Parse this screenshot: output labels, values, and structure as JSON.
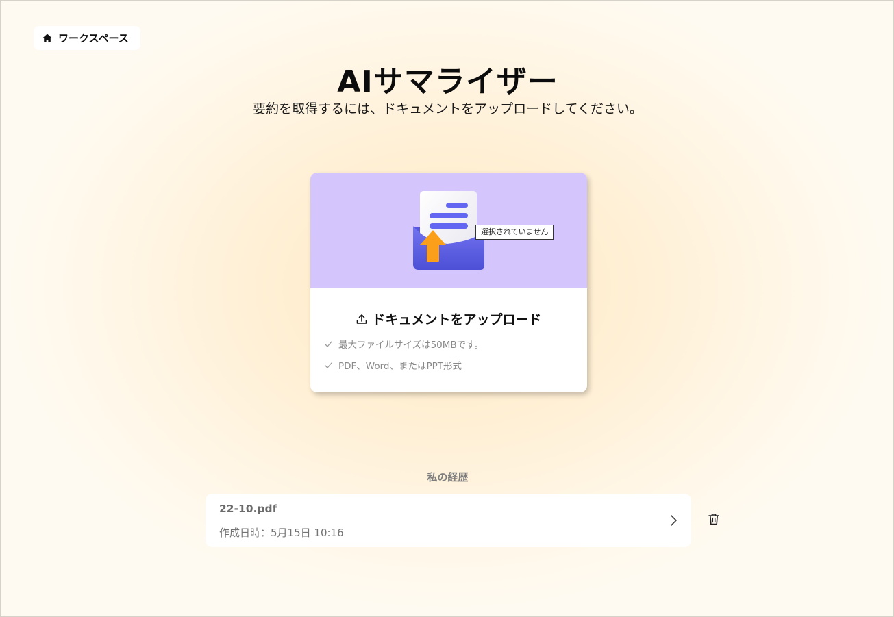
{
  "nav": {
    "workspace_label": "ワークスペース",
    "icon": "home-icon"
  },
  "header": {
    "title": "AIサマライザー",
    "subtitle": "要約を取得するには、ドキュメントをアップロードしてください。"
  },
  "upload": {
    "file_input_status": "選択されていません",
    "heading": "ドキュメントをアップロード",
    "features": [
      "最大ファイルサイズは50MBです。",
      "PDF、Word、またはPPT形式"
    ],
    "colors": {
      "hero_background": "#d4c6fd",
      "envelope": "#6366f1",
      "arrow": "#fb9f1a"
    }
  },
  "history": {
    "title": "私の経歴",
    "items": [
      {
        "file_name": "22-10.pdf",
        "created": "作成日時：5月15日 10:16"
      }
    ]
  }
}
